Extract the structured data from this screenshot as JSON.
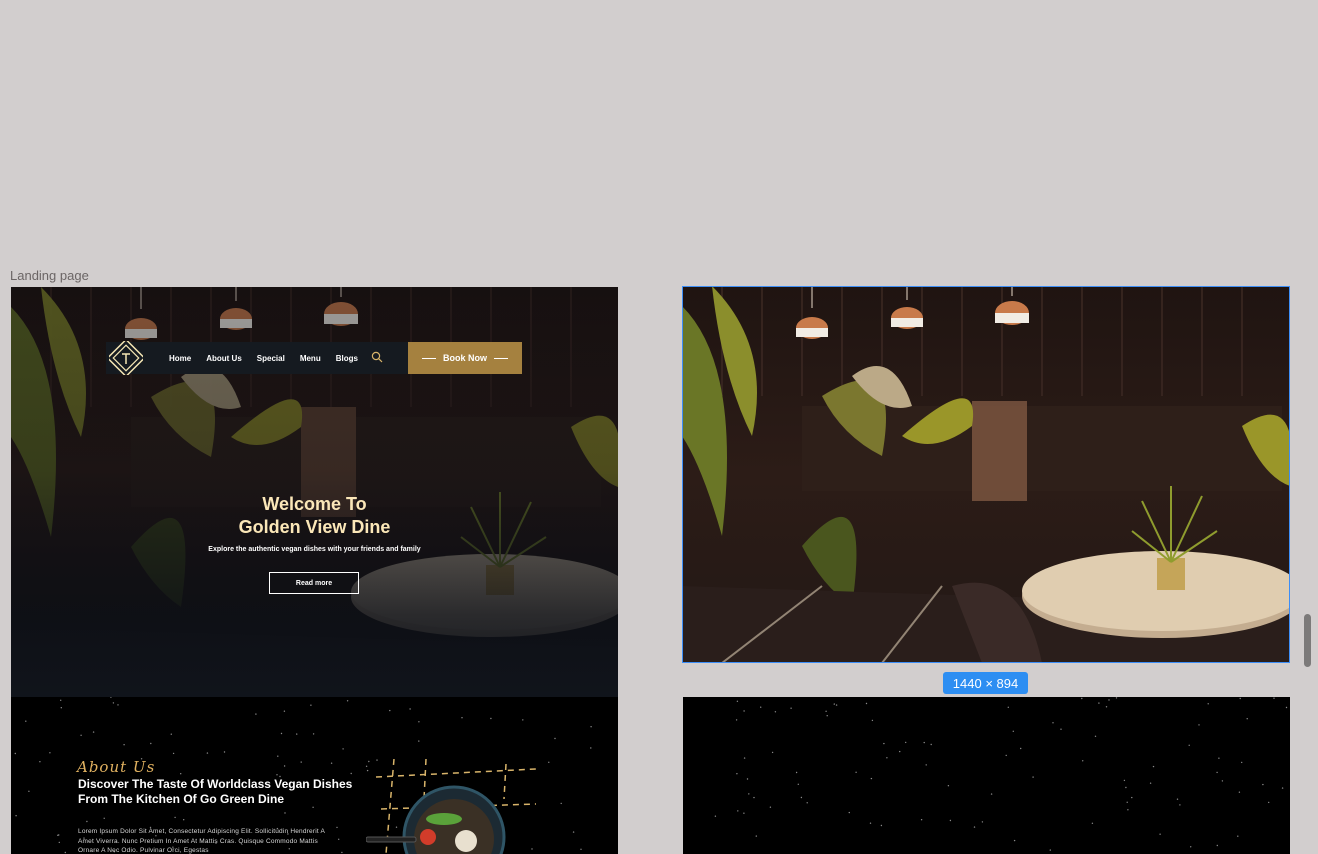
{
  "canvas": {
    "frame_label": "Landing page",
    "selection_size": "1440 × 894"
  },
  "landing": {
    "nav": {
      "links": [
        "Home",
        "About Us",
        "Special",
        "Menu",
        "Blogs"
      ],
      "book_label": "Book Now"
    },
    "hero": {
      "title_line1": "Welcome To",
      "title_line2": "Golden View Dine",
      "subtitle": "Explore the authentic vegan dishes with your friends and family",
      "cta_label": "Read more"
    },
    "about": {
      "script_title": "About Us",
      "heading": "Discover The Taste Of Worldclass Vegan Dishes From The Kitchen Of Go Green Dine",
      "body": "Lorem Ipsum Dolor Sit Amet, Consectetur Adipiscing Elit. Sollicitudin Hendrerit A Amet Viverra. Nunc Pretium In Amet At Mattis Cras. Quisque Commodo Mattis Ornare A Nec Odio. Pulvinar Orci, Egestas"
    }
  },
  "colors": {
    "canvas_bg": "#d2cece",
    "accent_gold": "#a5813f",
    "title_cream": "#fbe7b8",
    "selection_blue": "#2d8ef2"
  }
}
